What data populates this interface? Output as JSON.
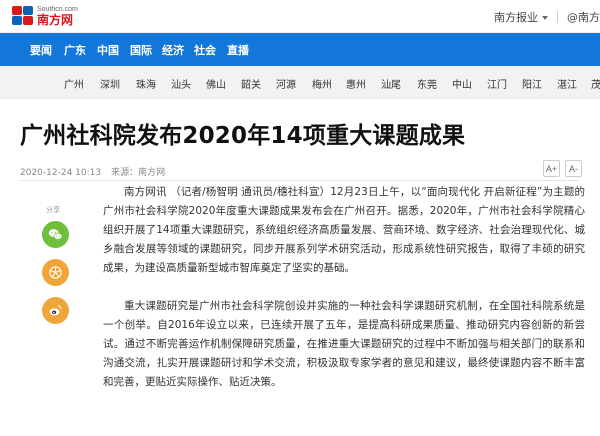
{
  "site": {
    "domain": "Southcn.com",
    "name": "南方网",
    "top_links": [
      {
        "label": "南方报业"
      },
      {
        "label": "@南方"
      }
    ]
  },
  "nav": {
    "items": [
      "要闻",
      "广东",
      "中国",
      "国际",
      "经济",
      "社会",
      "直播"
    ]
  },
  "cities": [
    "广州",
    "深圳",
    "珠海",
    "汕头",
    "佛山",
    "韶关",
    "河源",
    "梅州",
    "惠州",
    "汕尾",
    "东莞",
    "中山",
    "江门",
    "阳江",
    "湛江",
    "茂"
  ],
  "article": {
    "title": "广州社科院发布2020年14项重大课题成果",
    "date": "2020-12-24 10:13",
    "source": "来源：南方网",
    "font_larger": "A+",
    "font_smaller": "A-",
    "share_label": "分享",
    "paragraphs": [
      "南方网讯 （记者/杨智明 通讯员/穗社科宣）12月23日上午，以“面向现代化 开启新征程”为主题的广州市社会科学院2020年度重大课题成果发布会在广州召开。据悉，2020年，广州市社会科学院精心组织开展了14项重大课题研究，系统组织经济高质量发展、营商环境、数字经济、社会治理现代化、城乡融合发展等领域的课题研究，同步开展系列学术研究活动，形成系统性研究报告，取得了丰硕的研究成果，为建设高质量新型城市智库奠定了坚实的基础。",
      "重大课题研究是广州市社会科学院创设并实施的一种社会科学课题研究机制，在全国社科院系统是一个创举。自2016年设立以来，已连续开展了五年，是提高科研成果质量、推动研究内容创新的新尝试。通过不断完善运作机制保障研究质量，在推进重大课题研究的过程中不断加强与相关部门的联系和沟通交流，扎实开展课题研讨和学术交流，积极汲取专家学者的意见和建议，最终使课题内容不断丰富和完善，更贴近实际操作、贴近决策。"
    ]
  },
  "colors": {
    "nav_bg": "#1277d8",
    "brand_red": "#d7191e",
    "wechat": "#6fbf3d",
    "moments": "#f0a53a",
    "weibo": "#f0a53a"
  },
  "icons": [
    "wechat-icon",
    "moments-icon",
    "weibo-icon"
  ]
}
